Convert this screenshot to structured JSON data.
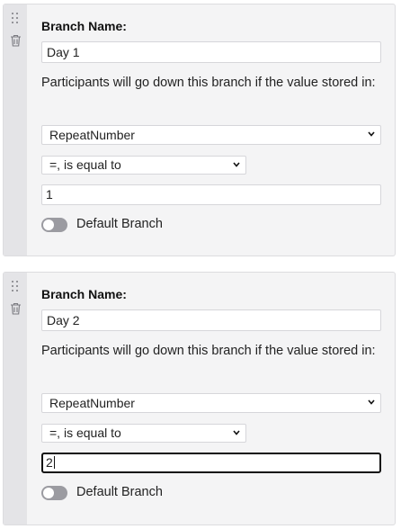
{
  "branches": [
    {
      "name_label": "Branch Name:",
      "name_value": "Day 1",
      "description": "Participants will go down this branch if the value stored in:",
      "variable_select": "RepeatNumber",
      "operator_select": "=, is equal to",
      "value": "1",
      "value_focused": false,
      "default_label": "Default Branch",
      "default_on": false,
      "icons": [
        "drag-handle-icon",
        "trash-icon",
        "chevron-down-icon"
      ]
    },
    {
      "name_label": "Branch Name:",
      "name_value": "Day 2",
      "description": "Participants will go down this branch if the value stored in:",
      "variable_select": "RepeatNumber",
      "operator_select": "=, is equal to",
      "value": "2",
      "value_focused": true,
      "default_label": "Default Branch",
      "default_on": false,
      "icons": [
        "drag-handle-icon",
        "trash-icon",
        "chevron-down-icon"
      ]
    }
  ],
  "colors": {
    "card_bg": "#f4f4f5",
    "gutter_bg": "#e4e4e7",
    "border": "#d6d6da",
    "toggle_off": "#9b9ba1",
    "focus_border": "#111111"
  }
}
